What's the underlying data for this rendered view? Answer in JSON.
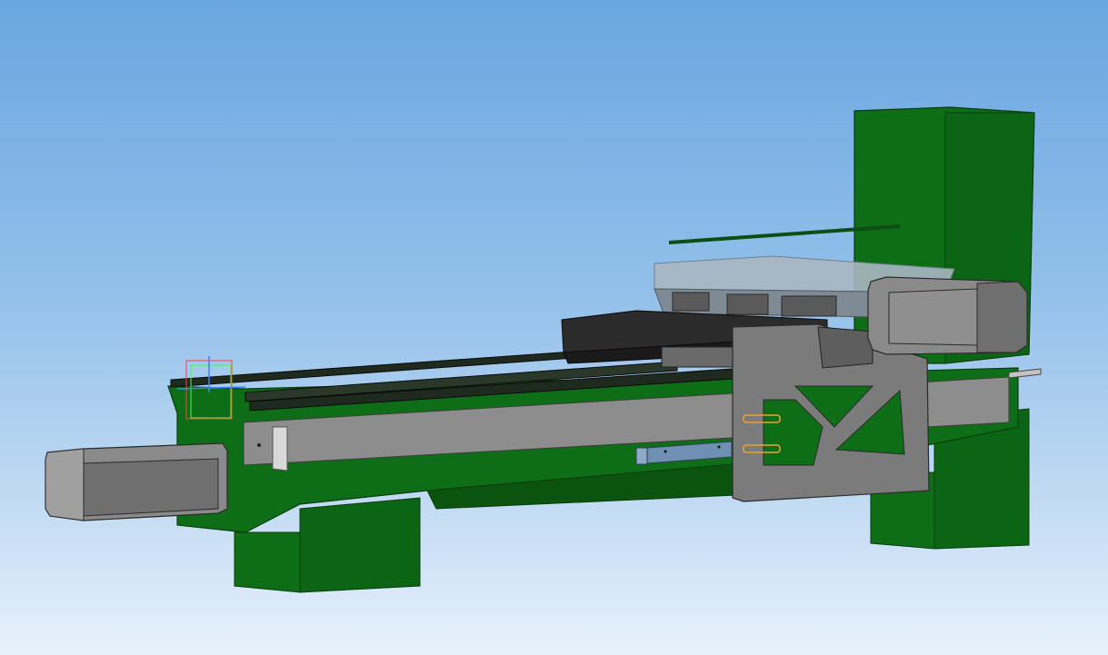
{
  "viewport": {
    "background_top": "#6aa6e0",
    "background_bottom": "#e8f1fb"
  },
  "colors": {
    "frame_green": "#0e6e17",
    "frame_green_dark": "#0a5410",
    "frame_green_light": "#168a22",
    "motor_gray": "#8a8a8a",
    "motor_gray_dark": "#6f6f6f",
    "plate_gray": "#7b7b7b",
    "rail_black": "#1f2a1f",
    "carriage_dark": "#2b2b2b",
    "sensor_blue": "#6f8fb3",
    "marker_orange": "#f0a030",
    "triad_red": "#ff4040",
    "triad_green": "#40ff40",
    "triad_blue": "#4080ff"
  },
  "model": {
    "parts": [
      "base-frame",
      "left-motor",
      "right-motor",
      "right-column",
      "linear-rails",
      "carriage-plate",
      "mesh-table",
      "sensor-bar",
      "origin-triad"
    ]
  }
}
